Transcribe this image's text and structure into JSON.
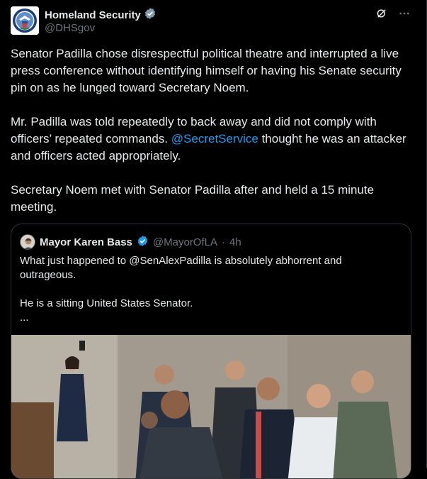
{
  "post": {
    "display_name": "Homeland Security",
    "handle": "@DHSgov",
    "paragraphs": {
      "p1": "Senator Padilla chose disrespectful political theatre and interrupted a live press conference without identifying himself or having his Senate security pin on as he lunged toward Secretary Noem.",
      "p2_before": "Mr. Padilla was told repeatedly to back away and did not comply with officers’ repeated commands. ",
      "p2_mention": "@SecretService",
      "p2_after": " thought he was an attacker and officers acted appropriately.",
      "p3": "Secretary Noem met with Senator Padilla after and held a 15 minute meeting."
    },
    "icons": {
      "verified": "verified-badge-icon",
      "grok": "grok-icon",
      "more": "more-icon"
    }
  },
  "quoted": {
    "display_name": "Mayor Karen Bass",
    "handle": "@MayorOfLA",
    "separator": "·",
    "time": "4h",
    "line1": "What just happened to @SenAlexPadilla is absolutely abhorrent and outrageous.",
    "line2": "He is a sitting United States Senator.",
    "ellipsis": "..."
  },
  "colors": {
    "background": "#000000",
    "text": "#e7e9ea",
    "muted": "#71767b",
    "link": "#1d9bf0",
    "verified": "#1d9bf0",
    "border": "#2f3336"
  }
}
